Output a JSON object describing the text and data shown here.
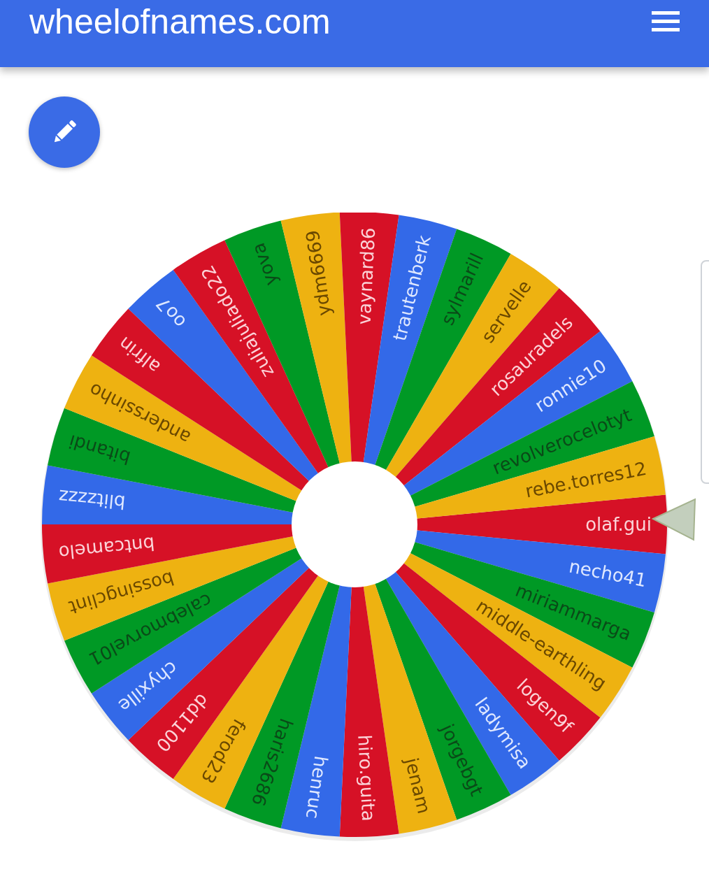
{
  "header": {
    "title": "wheelofnames.com"
  },
  "wheel": {
    "segments": [
      {
        "name": "olaf.gui",
        "color": "#d61126"
      },
      {
        "name": "necho41",
        "color": "#3369e8"
      },
      {
        "name": "miriammarga",
        "color": "#009925"
      },
      {
        "name": "middle-earthling",
        "color": "#eeb211"
      },
      {
        "name": "logen9f",
        "color": "#d61126"
      },
      {
        "name": "ladymisa",
        "color": "#3369e8"
      },
      {
        "name": "jorgebgt",
        "color": "#009925"
      },
      {
        "name": "jenam",
        "color": "#eeb211"
      },
      {
        "name": "hiro.guita",
        "color": "#d61126"
      },
      {
        "name": "henruc",
        "color": "#3369e8"
      },
      {
        "name": "haris2686",
        "color": "#009925"
      },
      {
        "name": "ferod23",
        "color": "#eeb211"
      },
      {
        "name": "dd1100",
        "color": "#d61126"
      },
      {
        "name": "chyxille",
        "color": "#3369e8"
      },
      {
        "name": "calebmorvel01",
        "color": "#009925"
      },
      {
        "name": "bossingclint",
        "color": "#eeb211"
      },
      {
        "name": "bntcamelo",
        "color": "#d61126"
      },
      {
        "name": "blitzzzz",
        "color": "#3369e8"
      },
      {
        "name": "bitandi",
        "color": "#009925"
      },
      {
        "name": "anderssinho",
        "color": "#eeb211"
      },
      {
        "name": "alfrin",
        "color": "#d61126"
      },
      {
        "name": "oo7",
        "color": "#3369e8"
      },
      {
        "name": "zuliajuliado22",
        "color": "#d61126"
      },
      {
        "name": "yova",
        "color": "#009925"
      },
      {
        "name": "ydm6669",
        "color": "#eeb211"
      },
      {
        "name": "vaynard86",
        "color": "#d61126"
      },
      {
        "name": "trautenberk",
        "color": "#3369e8"
      },
      {
        "name": "sylmarill",
        "color": "#009925"
      },
      {
        "name": "servelle",
        "color": "#eeb211"
      },
      {
        "name": "rosauradels",
        "color": "#d61126"
      },
      {
        "name": "ronnie10",
        "color": "#3369e8"
      },
      {
        "name": "revolverocelotyt",
        "color": "#009925"
      },
      {
        "name": "rebe.torres12",
        "color": "#eeb211"
      }
    ]
  }
}
